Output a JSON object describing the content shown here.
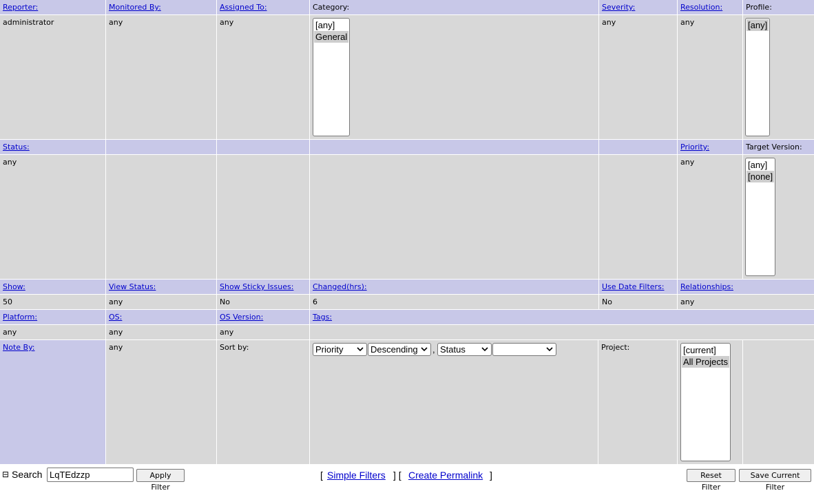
{
  "row1": {
    "reporter_label": "Reporter:",
    "monitored_by_label": "Monitored By:",
    "assigned_to_label": "Assigned To:",
    "category_label": "Category:",
    "severity_label": "Severity:",
    "resolution_label": "Resolution:",
    "profile_label": "Profile:",
    "reporter_value": "administrator",
    "monitored_by_value": "any",
    "assigned_to_value": "any",
    "category_options": [
      "[any]",
      "General"
    ],
    "severity_value": "any",
    "resolution_value": "any",
    "profile_options": [
      "[any]"
    ]
  },
  "row2": {
    "status_label": "Status:",
    "priority_label": "Priority:",
    "target_version_label": "Target Version:",
    "status_value": "any",
    "priority_value": "any",
    "target_version_options": [
      "[any]",
      "[none]"
    ]
  },
  "row3": {
    "show_label": "Show:",
    "view_status_label": "View Status:",
    "show_sticky_label": "Show Sticky Issues:",
    "changed_label": "Changed(hrs):",
    "use_date_filters_label": "Use Date Filters:",
    "relationships_label": "Relationships:",
    "show_value": "50",
    "view_status_value": "any",
    "show_sticky_value": "No",
    "changed_value": "6",
    "use_date_filters_value": "No",
    "relationships_value": "any"
  },
  "row4": {
    "platform_label": "Platform:",
    "os_label": "OS:",
    "os_version_label": "OS Version:",
    "tags_label": "Tags:",
    "platform_value": "any",
    "os_value": "any",
    "os_version_value": "any"
  },
  "row5": {
    "note_by_label": "Note By:",
    "note_by_value": "any",
    "sort_by_label": "Sort by:",
    "sort1_field": "Priority",
    "sort1_dir": "Descending",
    "sort2_field": "Status",
    "sort2_dir": "",
    "comma": ",",
    "project_label": "Project:",
    "project_options": [
      "[current]",
      "All Projects"
    ]
  },
  "footer": {
    "collapse_symbol": "⊟",
    "search_label": "Search",
    "search_value": "LqTEdzzp",
    "apply_filter": "Apply Filter",
    "bracket_open": "[",
    "simple_filters": "Simple Filters",
    "bracket_mid": "] [",
    "create_permalink": "Create Permalink",
    "bracket_close": "]",
    "reset_filter": "Reset Filter",
    "save_current_filter": "Save Current Filter"
  },
  "colors": {
    "header_bg": "#c8c8e8",
    "body_bg": "#d8d8d8",
    "link": "#0000cc"
  }
}
